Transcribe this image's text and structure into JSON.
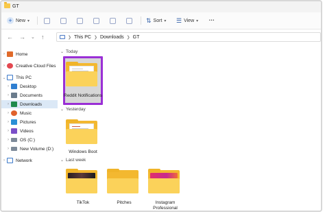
{
  "window": {
    "title": "GT"
  },
  "toolbar": {
    "new_label": "New",
    "sort_label": "Sort",
    "view_label": "View",
    "more_label": "•••",
    "icons": [
      "cut-icon",
      "copy-icon",
      "paste-icon",
      "rename-icon",
      "share-icon",
      "delete-icon"
    ]
  },
  "address": {
    "crumbs": [
      "This PC",
      "Downloads",
      "GT"
    ]
  },
  "sidebar": {
    "items": [
      {
        "label": "Home",
        "icon": "home-icon",
        "color": "#e06a2a"
      },
      {
        "label": "Creative Cloud Files",
        "icon": "cloud-icon",
        "color": "#e34850"
      },
      {
        "label": "This PC",
        "icon": "pc-icon",
        "color": "#3a78c9"
      },
      {
        "label": "Desktop",
        "icon": "desktop-icon",
        "color": "#2f7fd1"
      },
      {
        "label": "Documents",
        "icon": "documents-icon",
        "color": "#6a7b8c"
      },
      {
        "label": "Downloads",
        "icon": "downloads-icon",
        "color": "#1f8a4c"
      },
      {
        "label": "Music",
        "icon": "music-icon",
        "color": "#e0622c"
      },
      {
        "label": "Pictures",
        "icon": "pictures-icon",
        "color": "#2a8fd6"
      },
      {
        "label": "Videos",
        "icon": "videos-icon",
        "color": "#7a4fc9"
      },
      {
        "label": "OS (C:)",
        "icon": "drive-icon",
        "color": "#7d8a99"
      },
      {
        "label": "New Volume (D:)",
        "icon": "drive-icon",
        "color": "#7d8a99"
      },
      {
        "label": "Network",
        "icon": "network-icon",
        "color": "#3a78c9"
      }
    ],
    "selected": "Downloads"
  },
  "groups": {
    "today": {
      "label": "Today",
      "items": [
        {
          "label": "Reddit Notifications"
        }
      ]
    },
    "yesterday": {
      "label": "Yesterday",
      "items": [
        {
          "label": "Windows Boot"
        }
      ]
    },
    "last_week": {
      "label": "Last week",
      "items": [
        {
          "label": "TikTok"
        },
        {
          "label": "Pitches"
        },
        {
          "label": "Instagram Professional"
        }
      ]
    }
  },
  "colors": {
    "selection_outline": "#9a2fd6",
    "folder": "#f3b830",
    "accent": "#1f5fbf"
  }
}
